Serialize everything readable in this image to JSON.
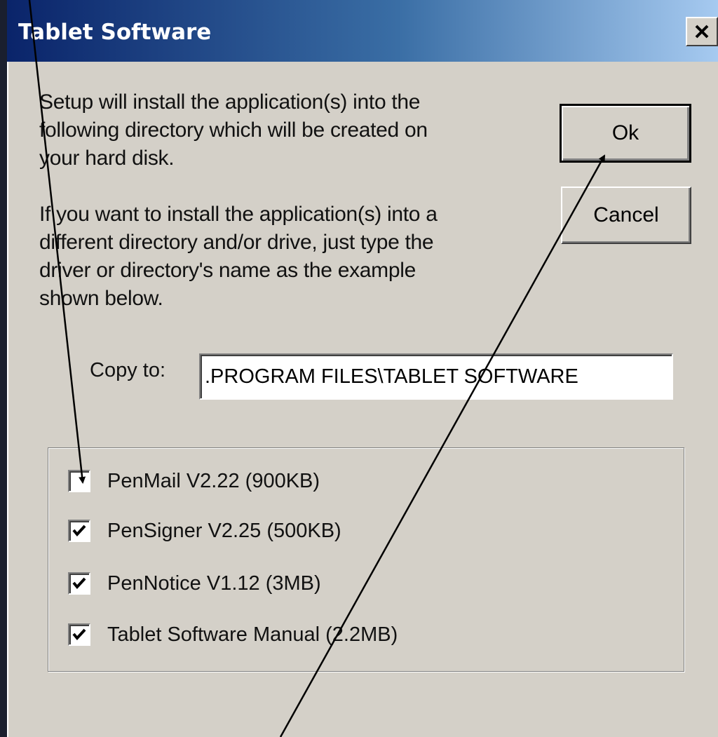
{
  "dialog": {
    "title": "Tablet Software",
    "close_symbol": "×"
  },
  "intro": {
    "paragraph1_lines": [
      "Setup will install the application(s) into the",
      "following directory which will be created on",
      "your hard disk."
    ],
    "paragraph2_lines": [
      "If you want to install the application(s) into a",
      "different directory and/or drive, just type the",
      "driver or directory's name as the example",
      "shown below."
    ]
  },
  "buttons": {
    "ok_label": "Ok",
    "cancel_label": "Cancel"
  },
  "copy_to": {
    "label": "Copy to:",
    "value": ".PROGRAM FILES\\TABLET SOFTWARE"
  },
  "components": [
    {
      "label": "PenMail V2.22 (900KB)",
      "checked": false
    },
    {
      "label": "PenSigner V2.25 (500KB)",
      "checked": true
    },
    {
      "label": "PenNotice V1.12 (3MB)",
      "checked": true
    },
    {
      "label": "Tablet Software Manual (2.2MB)",
      "checked": true
    }
  ],
  "colors": {
    "dialog_face": "#d4d0c8",
    "titlebar_start": "#0a246a",
    "titlebar_end": "#a6caf0",
    "annotation_line": "#000000"
  }
}
